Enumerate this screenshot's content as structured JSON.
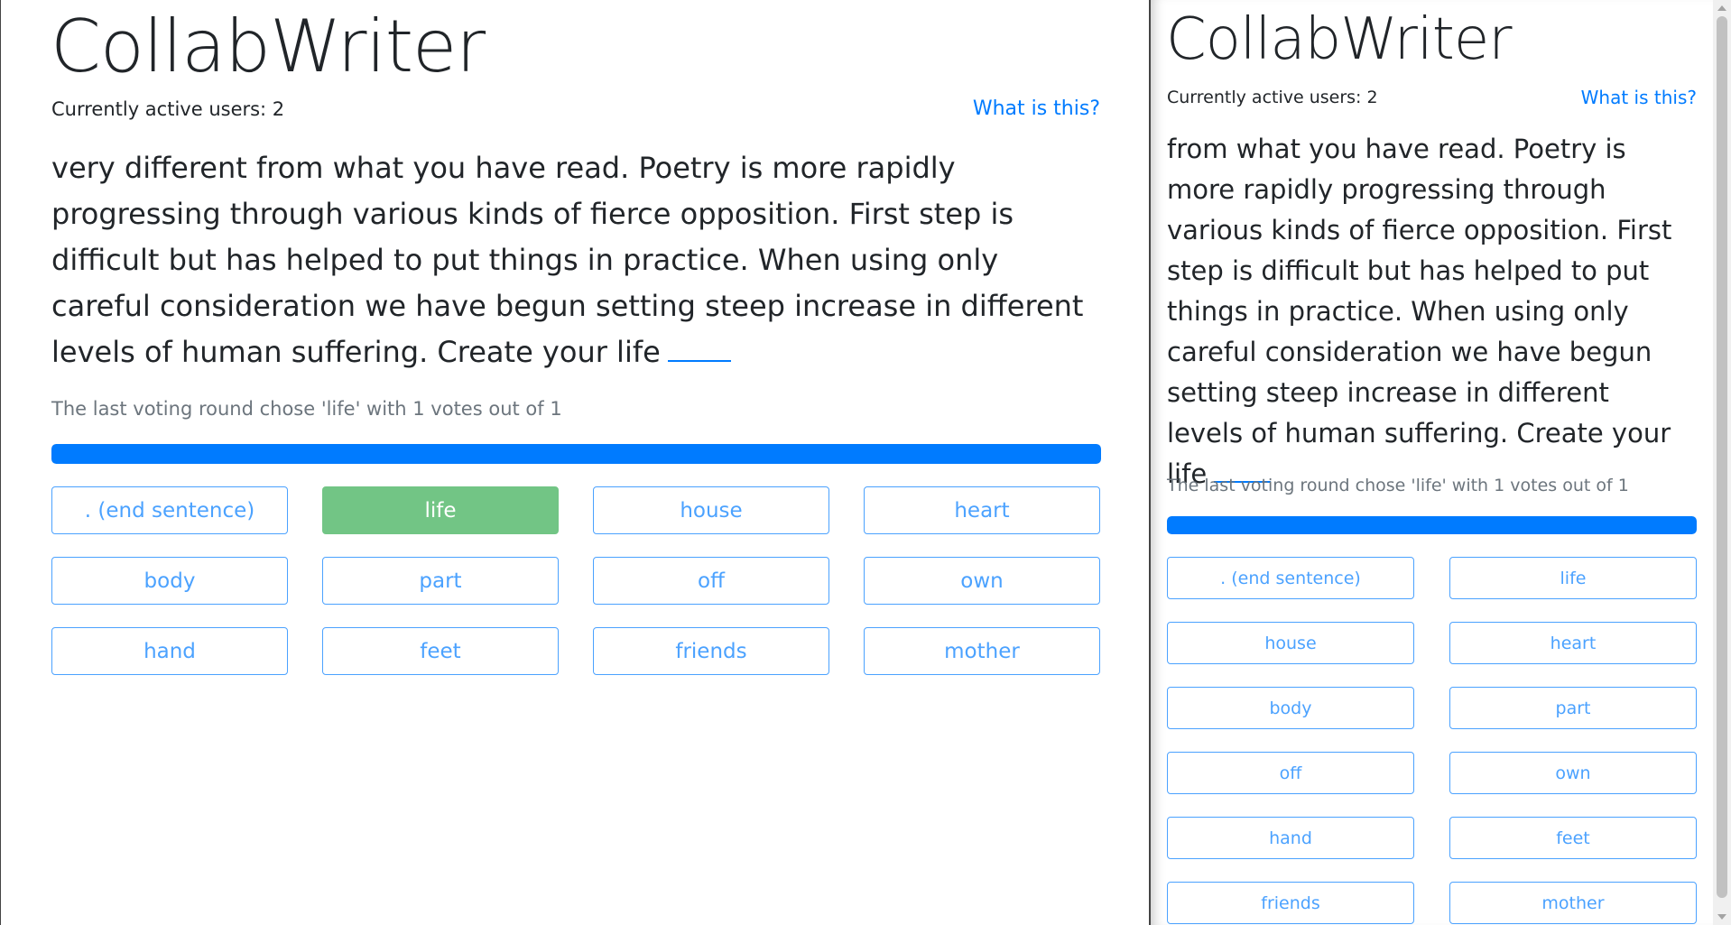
{
  "app": {
    "title": "CollabWriter",
    "active_users": "Currently active users: 2",
    "help_link": "What is this?"
  },
  "left": {
    "story": "very different from what you have read. Poetry is more rapidly progressing through various kinds of fierce opposition. First step is difficult but has helped to put things in practice. When using only careful consideration we have begun setting steep increase in different levels of human suffering. Create your life",
    "vote_info": "The last voting round chose 'life' with 1 votes out of 1",
    "progress_fraction": 1.0,
    "words": [
      ". (end sentence)",
      "life",
      "house",
      "heart",
      "body",
      "part",
      "off",
      "own",
      "hand",
      "feet",
      "friends",
      "mother"
    ],
    "selected_word": "life"
  },
  "right": {
    "story": "from what you have read. Poetry is more rapidly progressing through various kinds of fierce opposition. First step is difficult but has helped to put things in practice. When using only careful consideration we have begun setting steep increase in different levels of human suffering. Create your life",
    "vote_info": "The last voting round chose 'life' with 1 votes out of 1",
    "progress_fraction": 1.0,
    "words": [
      ". (end sentence)",
      "life",
      "house",
      "heart",
      "body",
      "part",
      "off",
      "own",
      "hand",
      "feet",
      "friends",
      "mother"
    ],
    "selected_word": ""
  },
  "colors": {
    "primary": "#007bff",
    "selected": "#28a745",
    "muted": "#6c757d"
  }
}
